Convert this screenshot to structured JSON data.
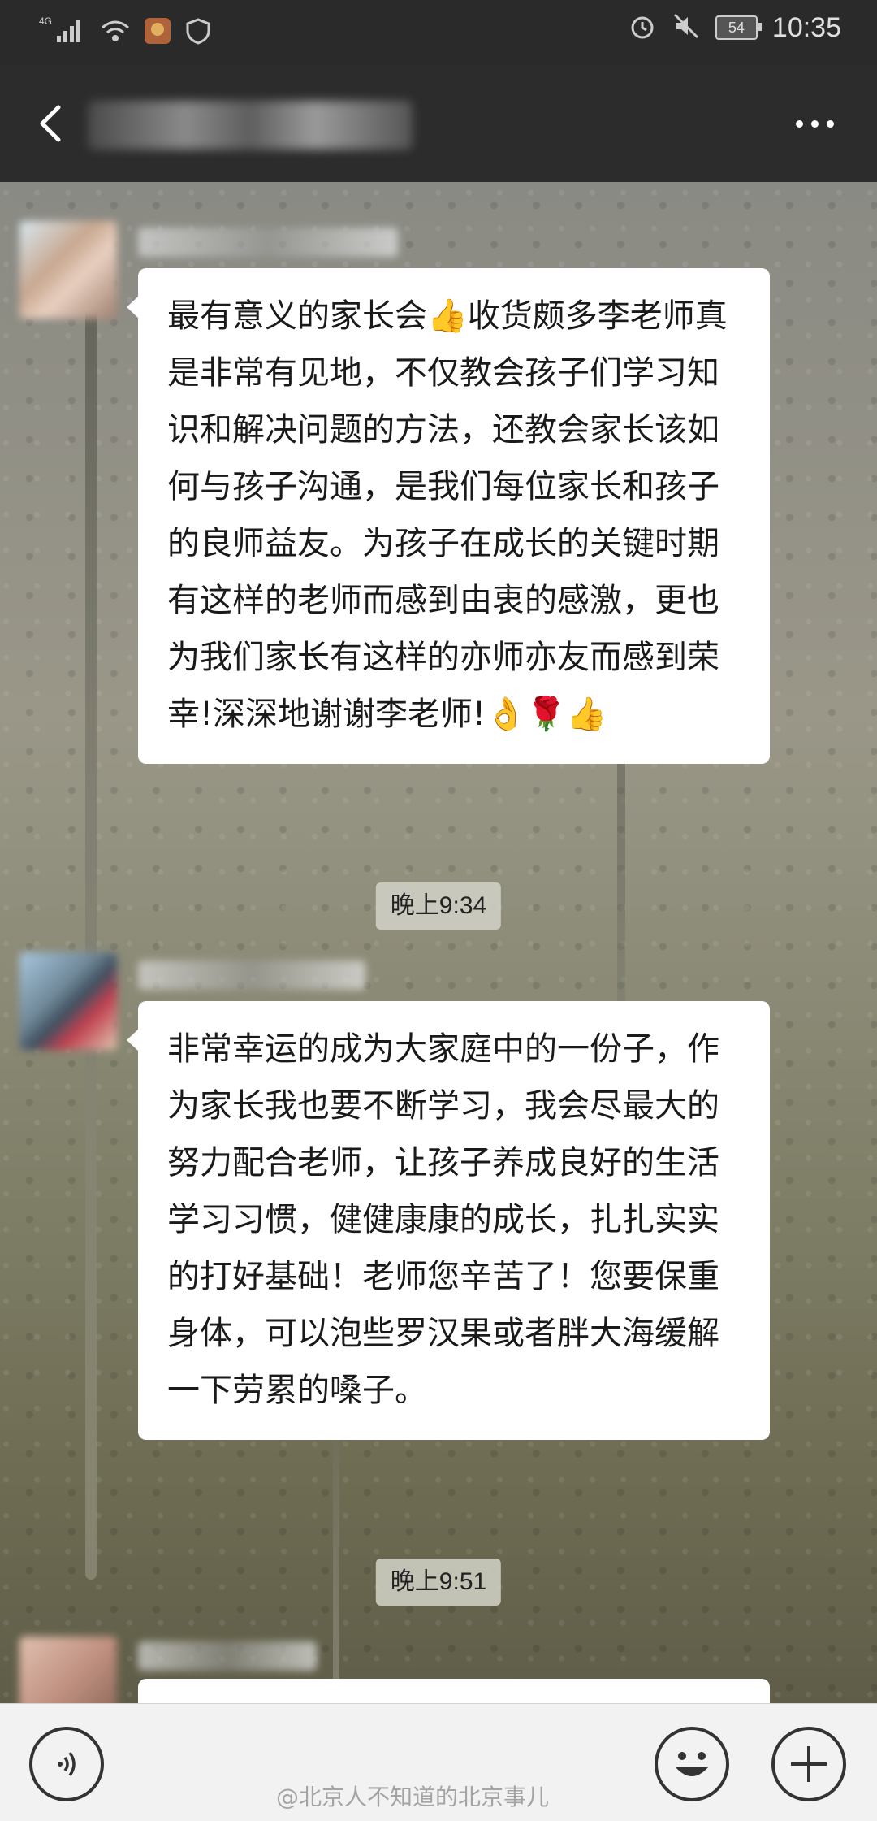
{
  "status_bar": {
    "network": "4G",
    "battery": "54",
    "time": "10:35",
    "icons": [
      "signal-icon",
      "wifi-icon",
      "app-icon",
      "shield-icon",
      "alarm-icon",
      "mute-icon",
      "battery-icon"
    ]
  },
  "title_bar": {
    "back_icon": "chevron-left-icon",
    "more_icon": "more-dots-icon"
  },
  "messages": [
    {
      "text": "最有意义的家长会👍收货颇多李老师真是非常有见地，不仅教会孩子们学习知识和解决问题的方法，还教会家长该如何与孩子沟通，是我们每位家长和孩子的良师益友。为孩子在成长的关键时期有这样的老师而感到由衷的感激，更也为我们家长有这样的亦师亦友而感到荣幸!深深地谢谢李老师!👌🌹👍"
    },
    {
      "text": "非常幸运的成为大家庭中的一份子，作为家长我也要不断学习，我会尽最大的努力配合老师，让孩子养成良好的生活学习习惯，健健康康的成长，扎扎实实的打好基础！老师您辛苦了！您要保重身体，可以泡些罗汉果或者胖大海缓解一下劳累的嗓子。"
    }
  ],
  "timestamps": [
    "晚上9:34",
    "晚上9:51"
  ],
  "input_bar": {
    "voice_icon": "voice-icon",
    "emoji_icon": "emoji-icon",
    "add_icon": "plus-icon"
  },
  "watermark": "@北京人不知道的北京事儿"
}
